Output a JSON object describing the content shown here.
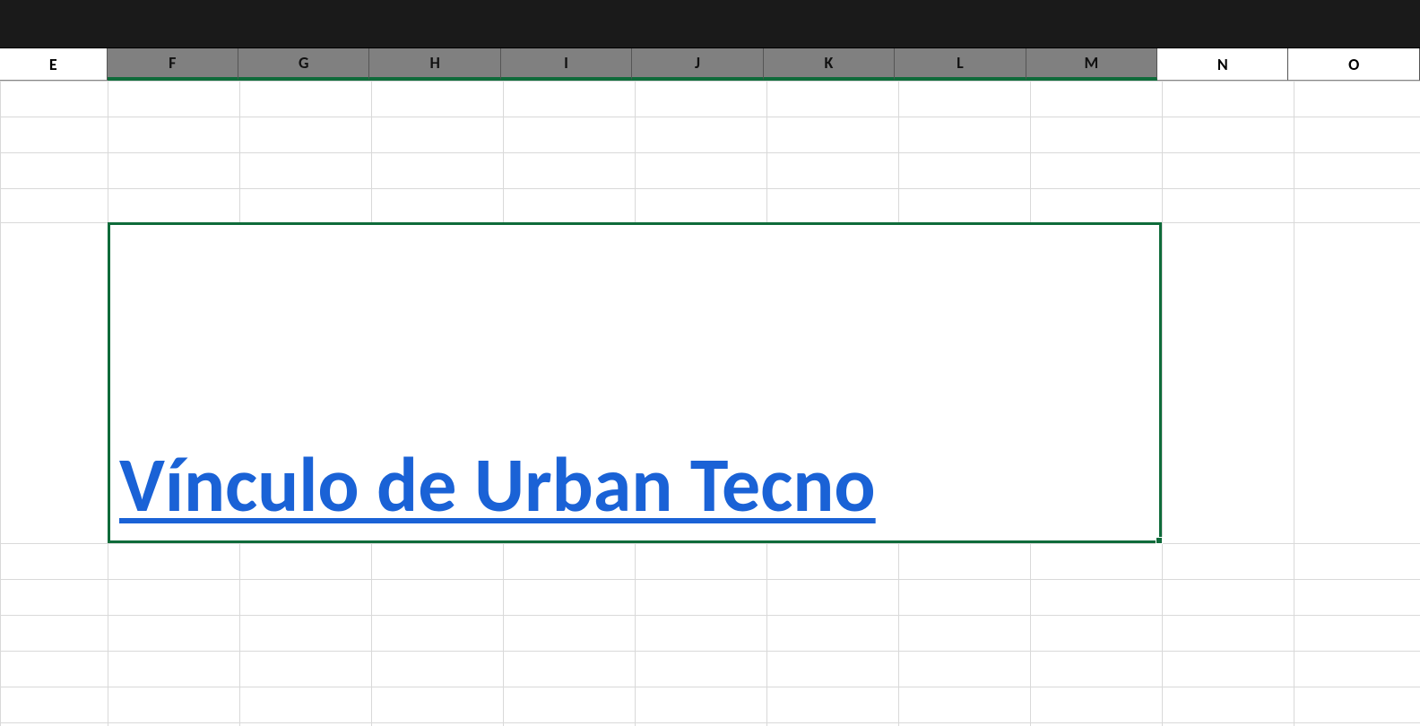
{
  "columns": {
    "E": "E",
    "F": "F",
    "G": "G",
    "H": "H",
    "I": "I",
    "J": "J",
    "K": "K",
    "L": "L",
    "M": "M",
    "N": "N",
    "O": "O"
  },
  "selected_columns": [
    "F",
    "G",
    "H",
    "I",
    "J",
    "K",
    "L",
    "M"
  ],
  "cell": {
    "link_text": "Vínculo de Urban Tecno"
  },
  "colors": {
    "selection_border": "#0f6b3a",
    "hyperlink": "#1a62d6",
    "header_selected": "#808080"
  }
}
